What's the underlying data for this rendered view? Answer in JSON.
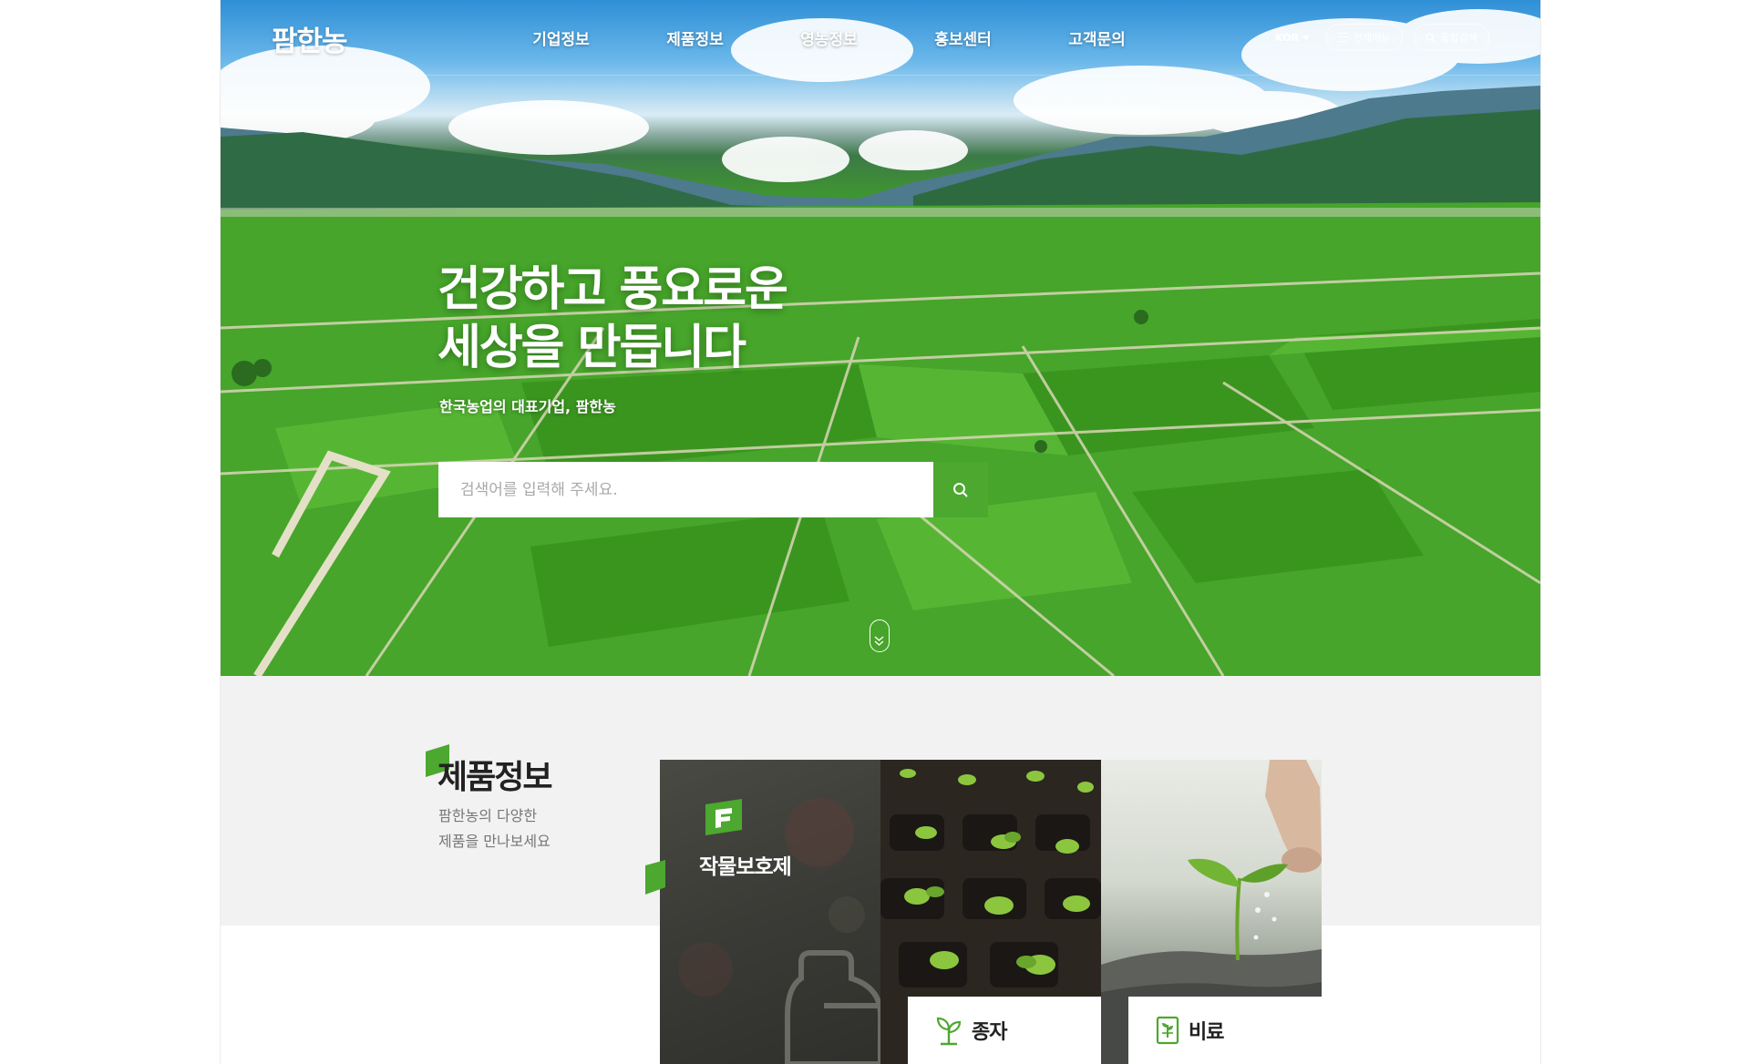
{
  "brand": {
    "logo_text": "팜한농",
    "accent": "#4ca82f"
  },
  "nav": {
    "items": [
      {
        "label": "기업정보"
      },
      {
        "label": "제품정보"
      },
      {
        "label": "영농정보"
      },
      {
        "label": "홍보센터"
      },
      {
        "label": "고객문의"
      }
    ]
  },
  "utility": {
    "language": "KOR",
    "all_menu_label": "전체메뉴",
    "search_label": "통합검색"
  },
  "hero": {
    "title_line1": "건강하고 풍요로운",
    "title_line2": "세상을 만듭니다",
    "subtitle": "한국농업의 대표기업, 팜한농",
    "search_placeholder": "검색어를 입력해 주세요."
  },
  "products": {
    "title": "제품정보",
    "desc_line1": "팜한농의 다양한",
    "desc_line2": "제품을 만나보세요",
    "cards": [
      {
        "label": "작물보호제",
        "icon": "farmhannong-f-icon"
      },
      {
        "label": "종자",
        "icon": "sprout-icon"
      },
      {
        "label": "비료",
        "icon": "fertilizer-bag-icon"
      }
    ]
  }
}
